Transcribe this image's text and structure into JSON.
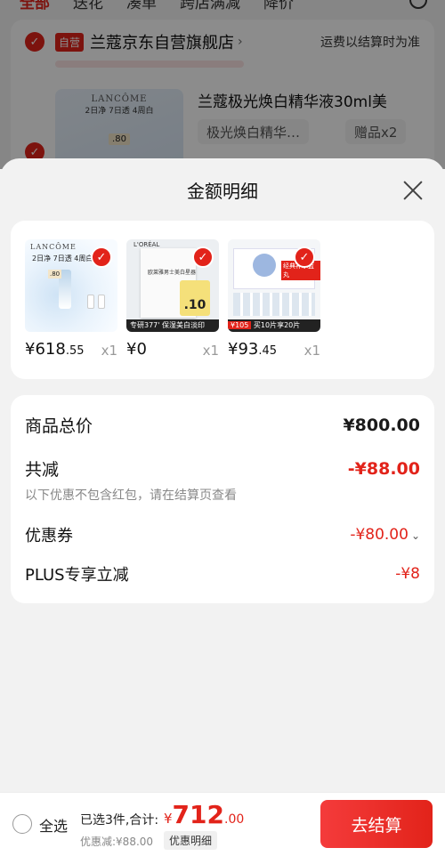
{
  "background": {
    "tabs": [
      "全部",
      "送花",
      "凑单",
      "跨店满减",
      "降价"
    ],
    "store": {
      "badge": "自营",
      "name": "兰蔻京东自营旗舰店",
      "shipping_note": "运费以结算时为准",
      "thumb_brand": "LANCÔME",
      "thumb_sub": "2日净 7日透 4周白",
      "thumb_tag": ".80",
      "product_title": "兰蔻极光焕白精华液30ml美",
      "spec": "极光焕白精华…",
      "gift": "赠品x2"
    }
  },
  "sheet": {
    "title": "金额明细",
    "products": [
      {
        "price_main": "¥618",
        "price_dec": ".55",
        "qty": "x1",
        "img_text": "LANCÔME",
        "img_sub": "2日净 7日透 4周白",
        "img_tag": ".80"
      },
      {
        "price_main": "¥0",
        "price_dec": "",
        "qty": "x1",
        "img_text": "L'ORÉAL",
        "img_sub": "欧莱雅男士美白星器",
        "img_num": ".10",
        "img_bar": "专研377' 保湿美白淡印"
      },
      {
        "price_main": "¥93",
        "price_dec": ".45",
        "qty": "x1",
        "img_text": "经典补水蓝丸",
        "img_price": "¥105",
        "img_bar": "买10片享20片"
      }
    ],
    "summary": {
      "total_label": "商品总价",
      "total_value": "¥800.00",
      "reduce_label": "共减",
      "reduce_value": "-¥88.00",
      "reduce_note": "以下优惠不包含红包，请在结算页查看",
      "coupon_label": "优惠券",
      "coupon_value": "-¥80.00",
      "plus_label": "PLUS专享立减",
      "plus_value": "-¥8"
    }
  },
  "bottom_bar": {
    "select_all": "全选",
    "selected_info": "已选3件,合计:",
    "currency": "¥",
    "total_int": "712",
    "total_dec": ".00",
    "discount": "优惠减:¥88.00",
    "detail": "优惠明细",
    "checkout": "去结算"
  },
  "colors": {
    "accent": "#e2231a",
    "background": "#f2f2f2"
  },
  "icons": [
    "check-icon",
    "close-icon",
    "chevron-down-icon",
    "search-icon",
    "radio-unchecked-icon"
  ]
}
